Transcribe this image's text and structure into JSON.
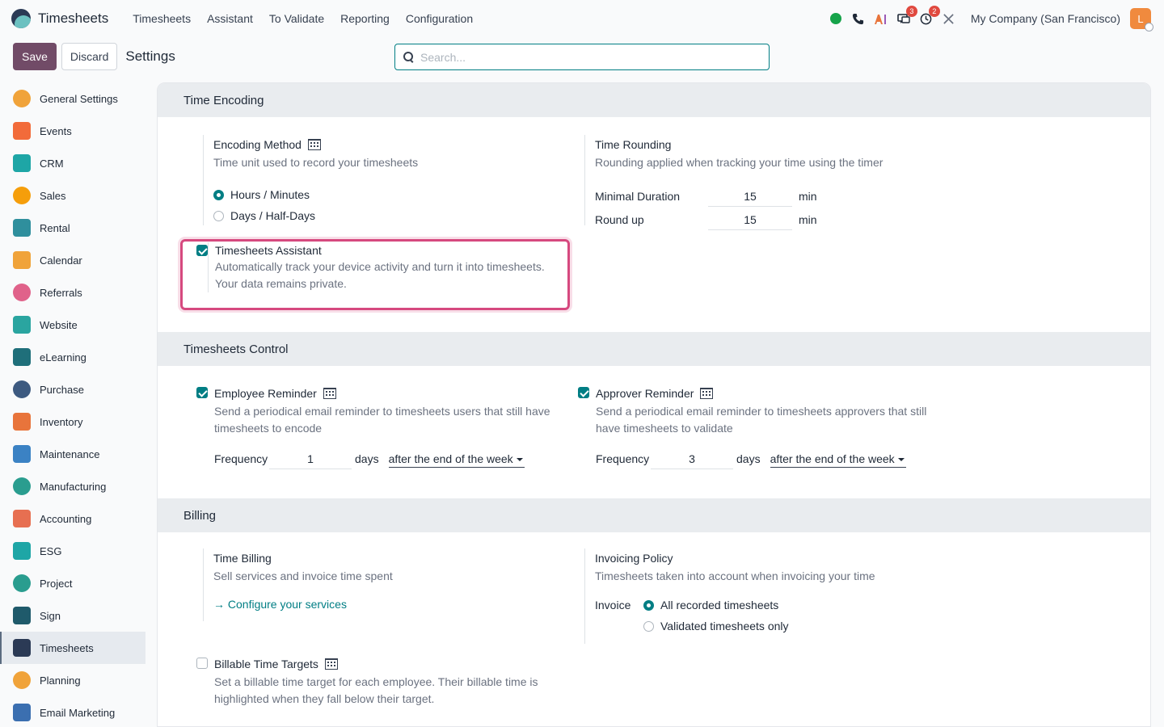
{
  "app": {
    "brand": "Timesheets",
    "menu": [
      "Timesheets",
      "Assistant",
      "To Validate",
      "Reporting",
      "Configuration"
    ],
    "company": "My Company (San Francisco)",
    "avatar_letter": "L",
    "badges": {
      "messages": "3",
      "activities": "2"
    }
  },
  "control": {
    "save": "Save",
    "discard": "Discard",
    "title": "Settings",
    "search_placeholder": "Search..."
  },
  "sidebar": {
    "items": [
      {
        "label": "General Settings",
        "color": "#f0a33a"
      },
      {
        "label": "Events",
        "color": "#f26b3a"
      },
      {
        "label": "CRM",
        "color": "#1ea6a6"
      },
      {
        "label": "Sales",
        "color": "#f59e0b"
      },
      {
        "label": "Rental",
        "color": "#2f8f9d"
      },
      {
        "label": "Calendar",
        "color": "#f0a33a"
      },
      {
        "label": "Referrals",
        "color": "#e0628a"
      },
      {
        "label": "Website",
        "color": "#2aa5a0"
      },
      {
        "label": "eLearning",
        "color": "#1f6f7a"
      },
      {
        "label": "Purchase",
        "color": "#3d5a80"
      },
      {
        "label": "Inventory",
        "color": "#e8743b"
      },
      {
        "label": "Maintenance",
        "color": "#3b82c4"
      },
      {
        "label": "Manufacturing",
        "color": "#2a9d8f"
      },
      {
        "label": "Accounting",
        "color": "#e76f51"
      },
      {
        "label": "ESG",
        "color": "#1ea6a6"
      },
      {
        "label": "Project",
        "color": "#2a9d8f"
      },
      {
        "label": "Sign",
        "color": "#1f5a6b"
      },
      {
        "label": "Timesheets",
        "color": "#2b3a55"
      },
      {
        "label": "Planning",
        "color": "#f0a33a"
      },
      {
        "label": "Email Marketing",
        "color": "#3b6fb0"
      }
    ],
    "active": "Timesheets"
  },
  "time_encoding": {
    "header": "Time Encoding",
    "encoding_method": {
      "title": "Encoding Method",
      "desc": "Time unit used to record your timesheets",
      "options": [
        "Hours / Minutes",
        "Days / Half-Days"
      ],
      "selected": "Hours / Minutes"
    },
    "time_rounding": {
      "title": "Time Rounding",
      "desc": "Rounding applied when tracking your time using the timer",
      "minimal_label": "Minimal Duration",
      "minimal_value": "15",
      "round_label": "Round up",
      "round_value": "15",
      "unit": "min"
    },
    "assistant": {
      "title": "Timesheets Assistant",
      "desc": "Automatically track your device activity and turn it into timesheets. Your data remains private.",
      "checked": true
    }
  },
  "control_section": {
    "header": "Timesheets Control",
    "employee": {
      "title": "Employee Reminder",
      "desc": "Send a periodical email reminder to timesheets users that still have timesheets to encode",
      "freq_label": "Frequency",
      "freq_value": "1",
      "unit": "days",
      "when": "after the end of the week",
      "checked": true
    },
    "approver": {
      "title": "Approver Reminder",
      "desc": "Send a periodical email reminder to timesheets approvers that still have timesheets to validate",
      "freq_label": "Frequency",
      "freq_value": "3",
      "unit": "days",
      "when": "after the end of the week",
      "checked": true
    }
  },
  "billing": {
    "header": "Billing",
    "time_billing": {
      "title": "Time Billing",
      "desc": "Sell services and invoice time spent",
      "link": "→ Configure your services"
    },
    "invoicing_policy": {
      "title": "Invoicing Policy",
      "desc": "Timesheets taken into account when invoicing your time",
      "label": "Invoice",
      "options": [
        "All recorded timesheets",
        "Validated timesheets only"
      ],
      "selected": "All recorded timesheets"
    },
    "targets": {
      "title": "Billable Time Targets",
      "desc": "Set a billable time target for each employee. Their billable time is highlighted when they fall below their target.",
      "checked": false
    }
  }
}
